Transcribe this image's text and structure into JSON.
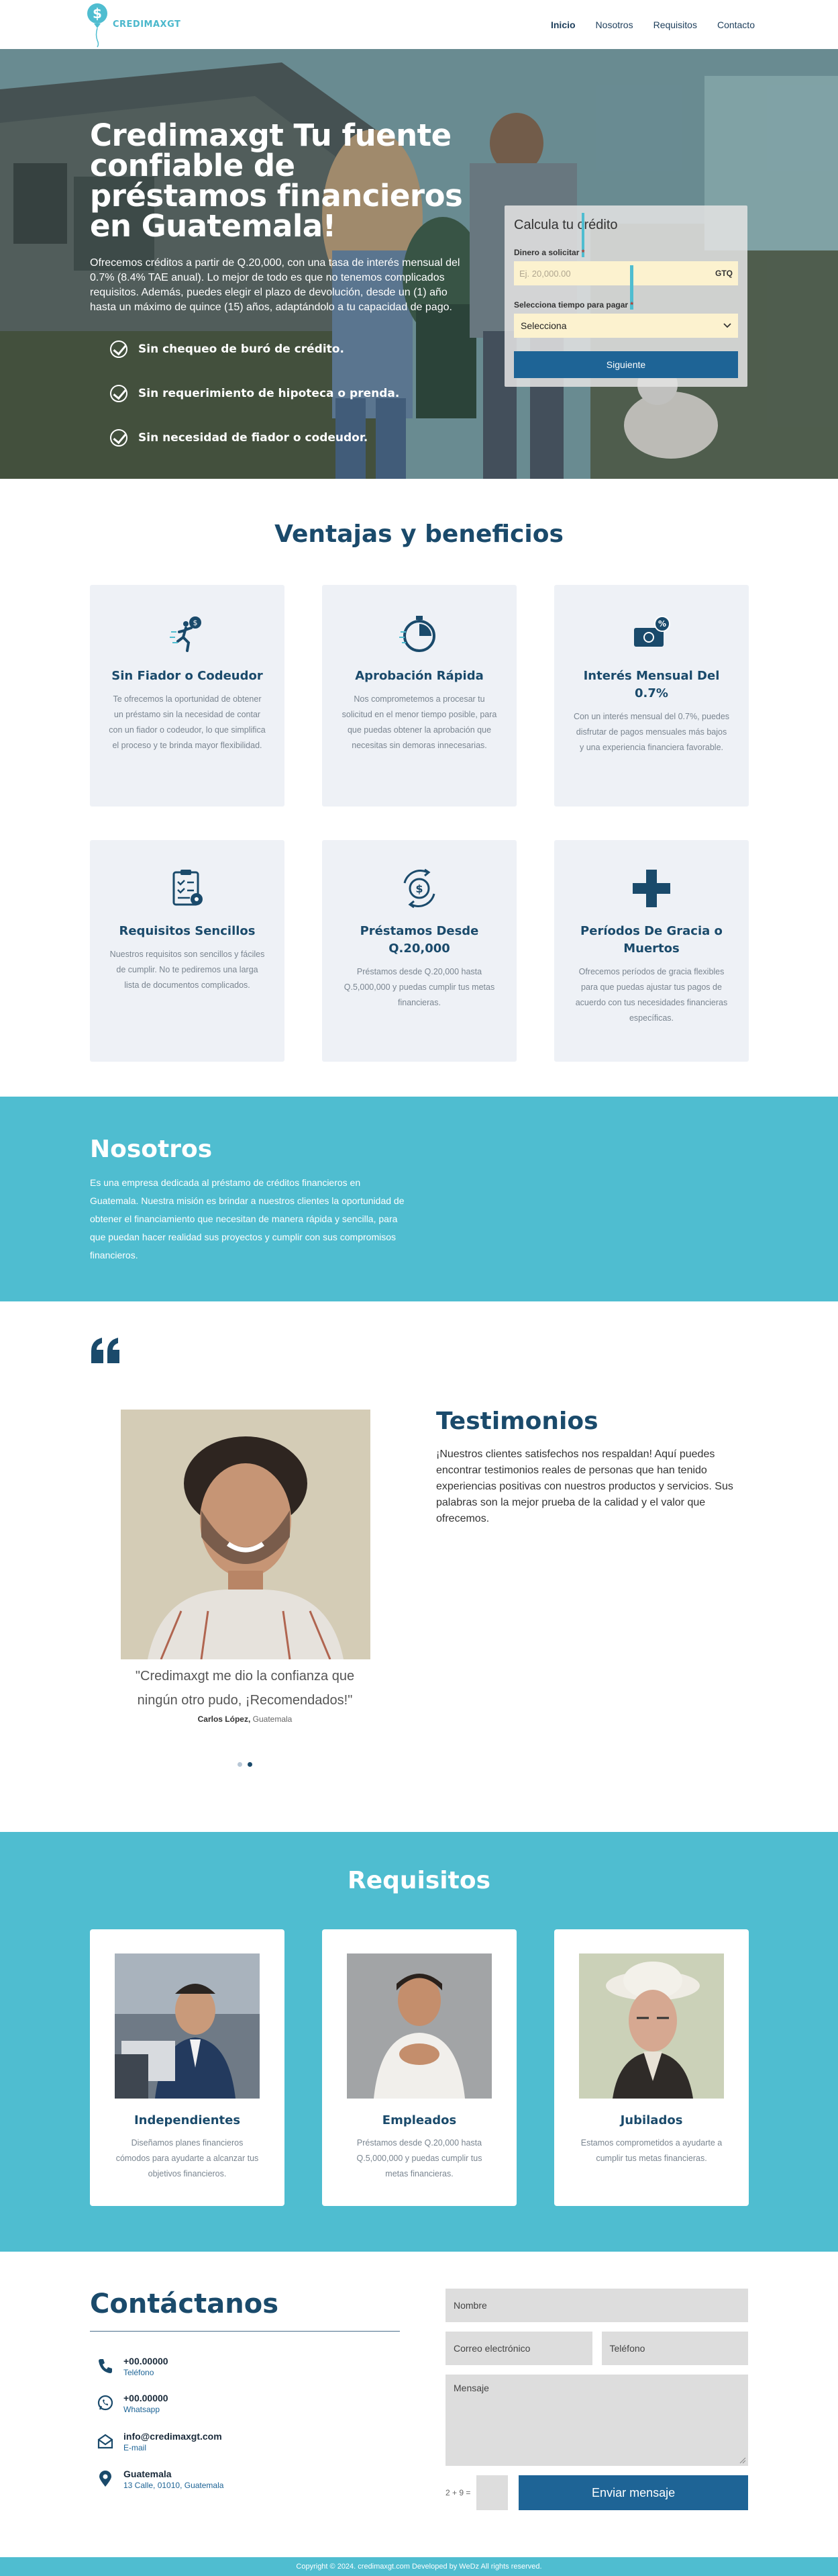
{
  "nav": {
    "brand": "CREDIMAXGT",
    "links": [
      {
        "label": "Inicio",
        "active": true
      },
      {
        "label": "Nosotros",
        "active": false
      },
      {
        "label": "Requisitos",
        "active": false
      },
      {
        "label": "Contacto",
        "active": false
      }
    ]
  },
  "hero": {
    "title": "Credimaxgt Tu fuente confiable de préstamos financieros en Guatemala!",
    "description": "Ofrecemos créditos a partir de Q.20,000, con una tasa de interés mensual del 0.7% (8.4% TAE anual). Lo mejor de todo es que no tenemos complicados requisitos. Además, puedes elegir el plazo de devolución, desde un (1) año hasta un máximo de quince (15) años, adaptándolo a tu capacidad de pago.",
    "checks": [
      "Sin chequeo de buró de crédito.",
      "Sin requerimiento de hipoteca o prenda.",
      "Sin necesidad de fiador o codeudor."
    ]
  },
  "calculator": {
    "title": "Calcula tu crédito",
    "amount_label": "Dinero a solicitar",
    "amount_placeholder": "Ej. 20,000.00",
    "currency": "GTQ",
    "term_label": "Selecciona tiempo para pagar",
    "term_value": "Selecciona",
    "submit": "Siguiente"
  },
  "benefits": {
    "title": "Ventajas y beneficios",
    "items": [
      {
        "title": "Sin Fiador o Codeudor",
        "desc": "Te ofrecemos la oportunidad de obtener un préstamo sin la necesidad de contar con un fiador o codeudor, lo que simplifica el proceso y te brinda mayor flexibilidad.",
        "icon": "running-person-icon"
      },
      {
        "title": "Aprobación Rápida",
        "desc": "Nos comprometemos a procesar tu solicitud en el menor tiempo posible, para que puedas obtener la aprobación que necesitas sin demoras innecesarias.",
        "icon": "stopwatch-icon"
      },
      {
        "title": "Interés Mensual Del 0.7%",
        "desc": "Con un interés mensual del 0.7%, puedes disfrutar de pagos mensuales más bajos y una experiencia financiera favorable.",
        "icon": "money-percent-icon"
      },
      {
        "title": "Requisitos Sencillos",
        "desc": "Nuestros requisitos son sencillos y fáciles de cumplir. No te pediremos una larga lista de documentos complicados.",
        "icon": "checklist-icon"
      },
      {
        "title": "Préstamos Desde Q.20,000",
        "desc": "Préstamos desde Q.20,000 hasta Q.5,000,000 y puedas cumplir tus metas financieras.",
        "icon": "money-exchange-icon"
      },
      {
        "title": "Períodos De Gracia o Muertos",
        "desc": "Ofrecemos períodos de gracia flexibles para que puedas ajustar tus pagos de acuerdo con tus necesidades financieras específicas.",
        "icon": "plus-icon"
      }
    ]
  },
  "about": {
    "title": "Nosotros",
    "text": "Es una empresa dedicada al préstamo de créditos financieros en Guatemala. Nuestra misión es brindar a nuestros clientes la oportunidad de obtener el financiamiento que necesitan de manera rápida y sencilla, para que puedan hacer realidad sus proyectos y cumplir con sus compromisos financieros."
  },
  "testimonials": {
    "title": "Testimonios",
    "text": "¡Nuestros clientes satisfechos nos respaldan! Aquí puedes encontrar testimonios reales de personas que han tenido experiencias positivas con nuestros productos y servicios. Sus palabras son la mejor prueba de la calidad y el valor que ofrecemos.",
    "quote": "\"Credimaxgt me dio la confianza que ningún otro pudo, ¡Recomendados!\"",
    "author": "Carlos López,",
    "location": "Guatemala"
  },
  "requirements": {
    "title": "Requisitos",
    "items": [
      {
        "title": "Independientes",
        "desc": "Diseñamos planes financieros cómodos para ayudarte a alcanzar tus objetivos financieros."
      },
      {
        "title": "Empleados",
        "desc": "Préstamos desde Q.20,000 hasta Q.5,000,000 y puedas cumplir tus metas financieras."
      },
      {
        "title": "Jubilados",
        "desc": "Estamos comprometidos a ayudarte a cumplir tus metas financieras."
      }
    ]
  },
  "contact": {
    "title": "Contáctanos",
    "items": [
      {
        "main": "+00.00000",
        "sub": "Teléfono"
      },
      {
        "main": "+00.00000",
        "sub": "Whatsapp"
      },
      {
        "main": "info@credimaxgt.com",
        "sub": "E-mail"
      },
      {
        "main": "Guatemala",
        "sub": "13 Calle, 01010, Guatemala"
      }
    ],
    "form": {
      "name": "Nombre",
      "email": "Correo electrónico",
      "phone": "Teléfono",
      "message": "Mensaje",
      "captcha": "2 + 9 =",
      "submit": "Enviar mensaje"
    }
  },
  "footer": {
    "text": "Copyright © 2024. credimaxgt.com Developed by WeDz All rights reserved."
  },
  "colors": {
    "primary": "#1a4a6b",
    "accent": "#4fbdd0",
    "button": "#1e6496"
  }
}
